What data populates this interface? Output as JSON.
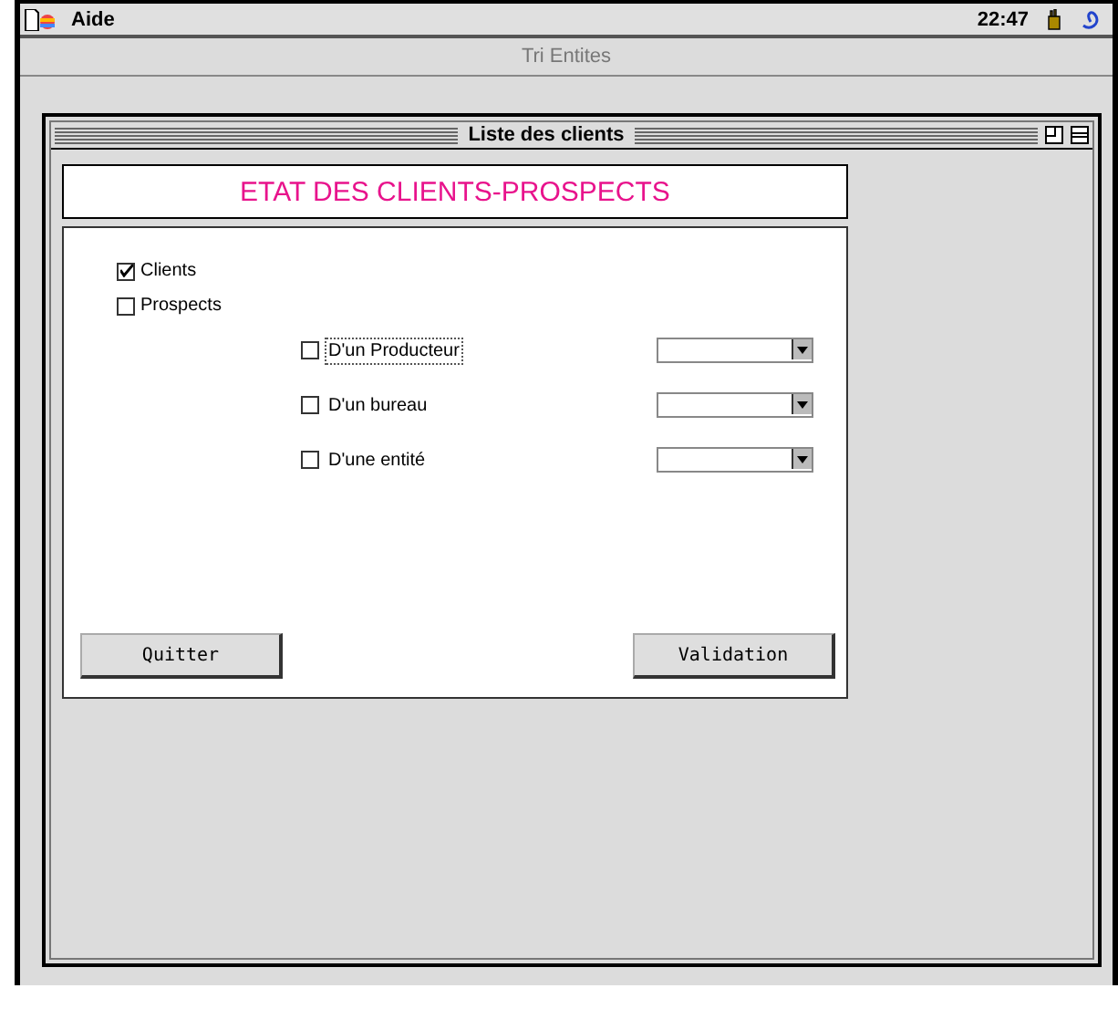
{
  "menu_bar": {
    "menus": [
      "Aide"
    ],
    "clock": "22:47"
  },
  "app_title": "Tri Entites",
  "window": {
    "title": "Liste des clients"
  },
  "header": "ETAT DES CLIENTS-PROSPECTS",
  "options": [
    {
      "label": "Clients",
      "checked": true
    },
    {
      "label": "Prospects",
      "checked": false
    }
  ],
  "filters": [
    {
      "label": "D'un Producteur",
      "checked": false,
      "focused": true
    },
    {
      "label": "D'un bureau",
      "checked": false,
      "focused": false
    },
    {
      "label": "D'une entité",
      "checked": false,
      "focused": false
    }
  ],
  "buttons": [
    "Quitter",
    "Validation"
  ]
}
